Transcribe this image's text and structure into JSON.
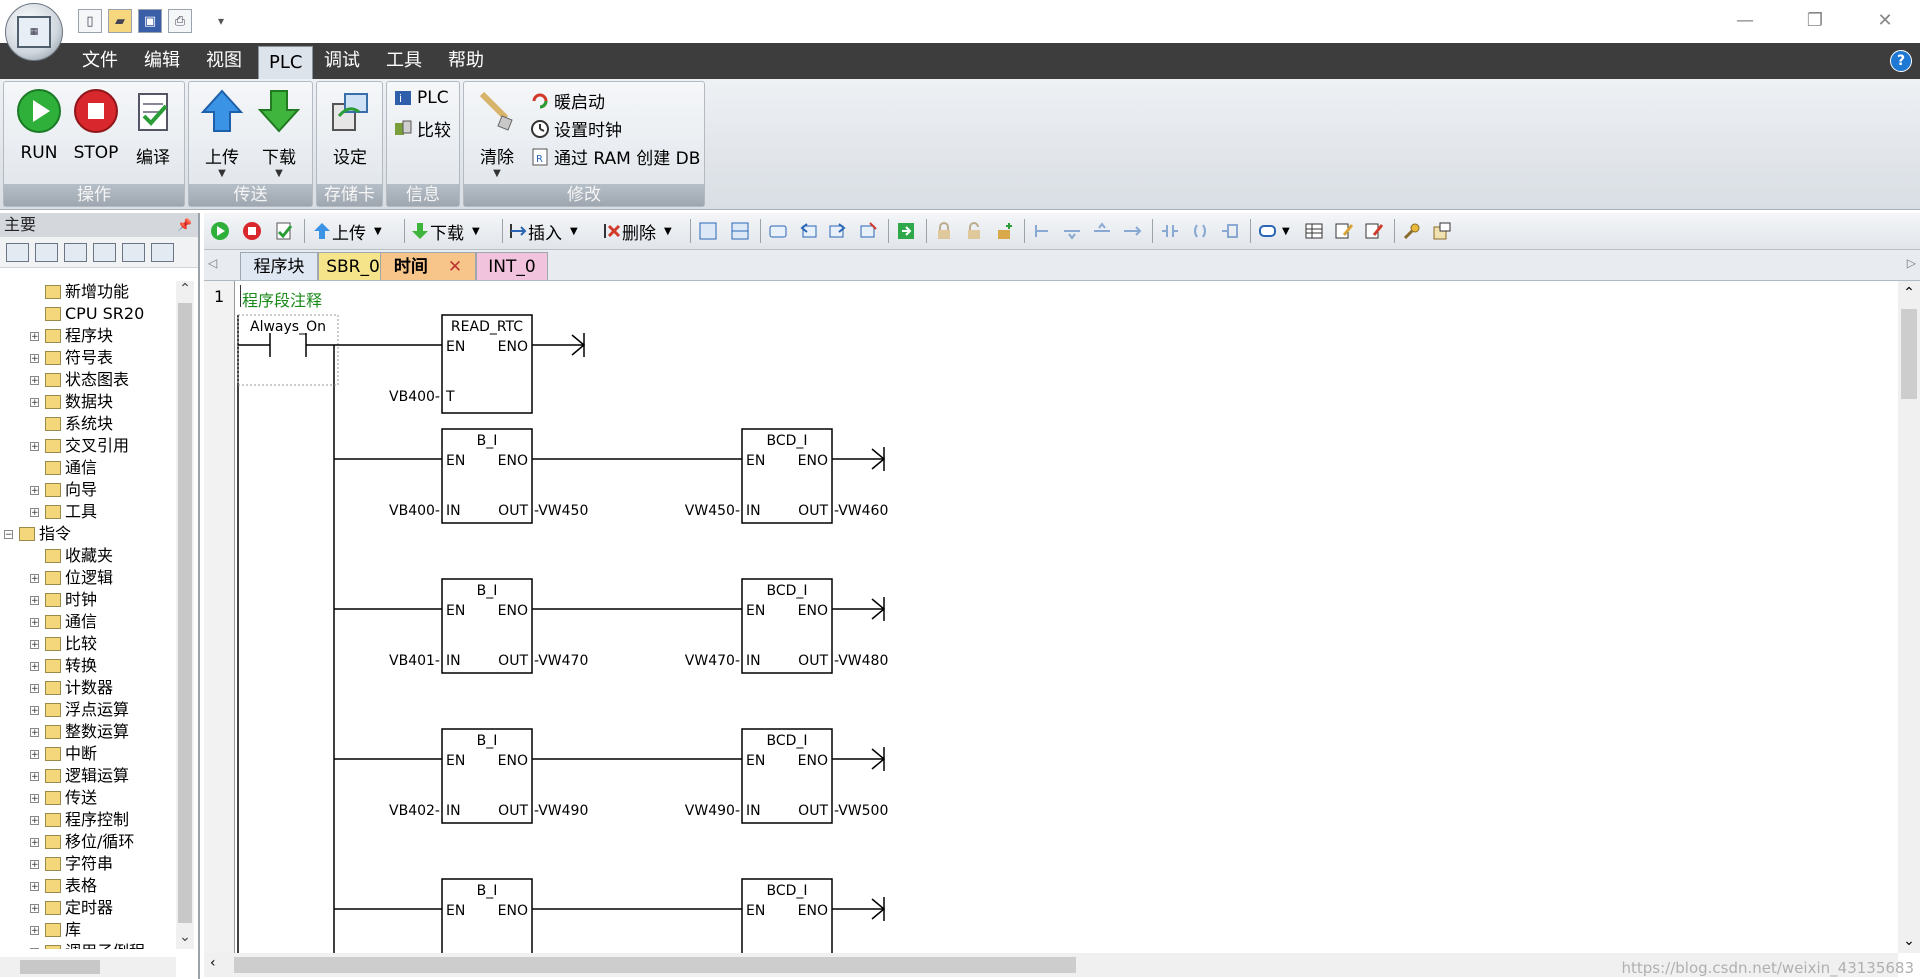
{
  "menu": {
    "items": [
      "文件",
      "编辑",
      "视图",
      "PLC",
      "调试",
      "工具",
      "帮助"
    ],
    "active": "PLC"
  },
  "ribbon": {
    "groups": [
      {
        "label": "操作",
        "buttons": [
          "RUN",
          "STOP",
          "编译"
        ]
      },
      {
        "label": "传送",
        "buttons": [
          "上传",
          "下载"
        ]
      },
      {
        "label": "存储卡",
        "buttons": [
          "设定"
        ]
      },
      {
        "label": "信息",
        "buttons": [
          "PLC",
          "比较"
        ]
      },
      {
        "label": "修改",
        "buttons": [
          "清除",
          "暖启动",
          "设置时钟",
          "通过 RAM 创建 DB"
        ]
      }
    ]
  },
  "left_pane": {
    "title": "主要",
    "tree": [
      {
        "label": "新增功能",
        "level": 2,
        "expand": false
      },
      {
        "label": "CPU SR20",
        "level": 2,
        "expand": false
      },
      {
        "label": "程序块",
        "level": 2,
        "expand": true
      },
      {
        "label": "符号表",
        "level": 2,
        "expand": true
      },
      {
        "label": "状态图表",
        "level": 2,
        "expand": true
      },
      {
        "label": "数据块",
        "level": 2,
        "expand": true
      },
      {
        "label": "系统块",
        "level": 2,
        "expand": false
      },
      {
        "label": "交叉引用",
        "level": 2,
        "expand": true
      },
      {
        "label": "通信",
        "level": 2,
        "expand": false
      },
      {
        "label": "向导",
        "level": 2,
        "expand": true
      },
      {
        "label": "工具",
        "level": 2,
        "expand": true
      },
      {
        "label": "指令",
        "level": 1,
        "expand": true
      },
      {
        "label": "收藏夹",
        "level": 2,
        "expand": false
      },
      {
        "label": "位逻辑",
        "level": 2,
        "expand": true
      },
      {
        "label": "时钟",
        "level": 2,
        "expand": true
      },
      {
        "label": "通信",
        "level": 2,
        "expand": true
      },
      {
        "label": "比较",
        "level": 2,
        "expand": true
      },
      {
        "label": "转换",
        "level": 2,
        "expand": true
      },
      {
        "label": "计数器",
        "level": 2,
        "expand": true
      },
      {
        "label": "浮点运算",
        "level": 2,
        "expand": true
      },
      {
        "label": "整数运算",
        "level": 2,
        "expand": true
      },
      {
        "label": "中断",
        "level": 2,
        "expand": true
      },
      {
        "label": "逻辑运算",
        "level": 2,
        "expand": true
      },
      {
        "label": "传送",
        "level": 2,
        "expand": true
      },
      {
        "label": "程序控制",
        "level": 2,
        "expand": true
      },
      {
        "label": "移位/循环",
        "level": 2,
        "expand": true
      },
      {
        "label": "字符串",
        "level": 2,
        "expand": true
      },
      {
        "label": "表格",
        "level": 2,
        "expand": true
      },
      {
        "label": "定时器",
        "level": 2,
        "expand": true
      },
      {
        "label": "库",
        "level": 2,
        "expand": true
      },
      {
        "label": "调用子例程",
        "level": 2,
        "expand": true
      }
    ]
  },
  "editor_toolbar": {
    "upload": "上传",
    "download": "下载",
    "insert": "插入",
    "delete": "删除"
  },
  "tabs": [
    {
      "label": "程序块",
      "color": "#dfe7f3"
    },
    {
      "label": "SBR_0",
      "color": "#f6e48a"
    },
    {
      "label": "时间",
      "color": "#f7c58a",
      "active": true,
      "close": "✕"
    },
    {
      "label": "INT_0",
      "color": "#f2c3dc"
    }
  ],
  "network": {
    "number": "1",
    "comment": "程序段注释",
    "contact": "Always_On",
    "rtc": {
      "title": "READ_RTC",
      "en": "EN",
      "eno": "ENO",
      "t_label": "T",
      "operand": "VB400"
    },
    "rows": [
      {
        "bi_title": "B_I",
        "bi_in": "VB400",
        "bi_out": "VW450",
        "bcd_title": "BCD_I",
        "bcd_in": "VW450",
        "bcd_out": "VW460"
      },
      {
        "bi_title": "B_I",
        "bi_in": "VB401",
        "bi_out": "VW470",
        "bcd_title": "BCD_I",
        "bcd_in": "VW470",
        "bcd_out": "VW480"
      },
      {
        "bi_title": "B_I",
        "bi_in": "VB402",
        "bi_out": "VW490",
        "bcd_title": "BCD_I",
        "bcd_in": "VW490",
        "bcd_out": "VW500"
      },
      {
        "bi_title": "B_I",
        "bi_in": "",
        "bi_out": "",
        "bcd_title": "BCD_I",
        "bcd_in": "",
        "bcd_out": ""
      }
    ],
    "pins": {
      "en": "EN",
      "eno": "ENO",
      "in": "IN",
      "out": "OUT"
    }
  },
  "watermark": "https://blog.csdn.net/weixin_43135683"
}
